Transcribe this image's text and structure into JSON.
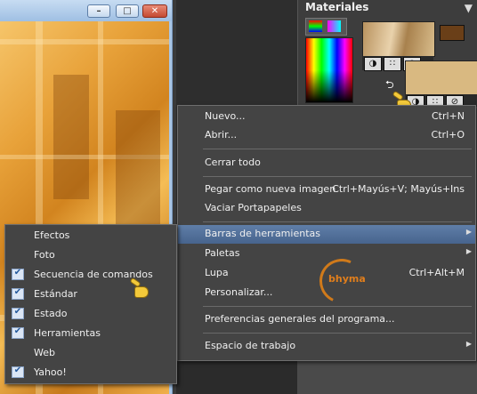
{
  "materials_panel": {
    "title": "Materiales",
    "close_symbol": "▼",
    "swap_symbol": "⮌",
    "fg_controls": [
      "◑",
      "∷",
      "⊘"
    ],
    "bg_controls": [
      "◑",
      "∷",
      "⊘"
    ]
  },
  "window_buttons": {
    "minimize": "–",
    "maximize": "□",
    "close": "✕"
  },
  "main_menu": {
    "items": [
      {
        "label": "Nuevo...",
        "shortcut": "Ctrl+N"
      },
      {
        "label": "Abrir...",
        "shortcut": "Ctrl+O"
      },
      {
        "label": "Cerrar todo",
        "shortcut": ""
      },
      {
        "label": "Pegar como nueva imagen",
        "shortcut": "Ctrl+Mayús+V; Mayús+Ins"
      },
      {
        "label": "Vaciar Portapapeles",
        "shortcut": ""
      },
      {
        "label": "Barras de herramientas",
        "shortcut": "",
        "submenu": true
      },
      {
        "label": "Paletas",
        "shortcut": "",
        "submenu": true
      },
      {
        "label": "Lupa",
        "shortcut": "Ctrl+Alt+M"
      },
      {
        "label": "Personalizar...",
        "shortcut": ""
      },
      {
        "label": "Preferencias generales del programa...",
        "shortcut": ""
      },
      {
        "label": "Espacio de trabajo",
        "shortcut": "",
        "submenu": true
      }
    ],
    "submenu_arrow": "▶"
  },
  "toolbars_submenu": {
    "items": [
      {
        "label": "Efectos",
        "checked": false
      },
      {
        "label": "Foto",
        "checked": false
      },
      {
        "label": "Secuencia de comandos",
        "checked": true
      },
      {
        "label": "Estándar",
        "checked": true
      },
      {
        "label": "Estado",
        "checked": true
      },
      {
        "label": "Herramientas",
        "checked": true
      },
      {
        "label": "Web",
        "checked": false
      },
      {
        "label": "Yahoo!",
        "checked": true
      }
    ],
    "check_symbol": "✔"
  },
  "watermark": {
    "text": "bhyma"
  },
  "colors": {
    "menu_highlight": "#5f7ea8",
    "foreground_color": "#6a3f18",
    "background_color": "#d9b981"
  }
}
